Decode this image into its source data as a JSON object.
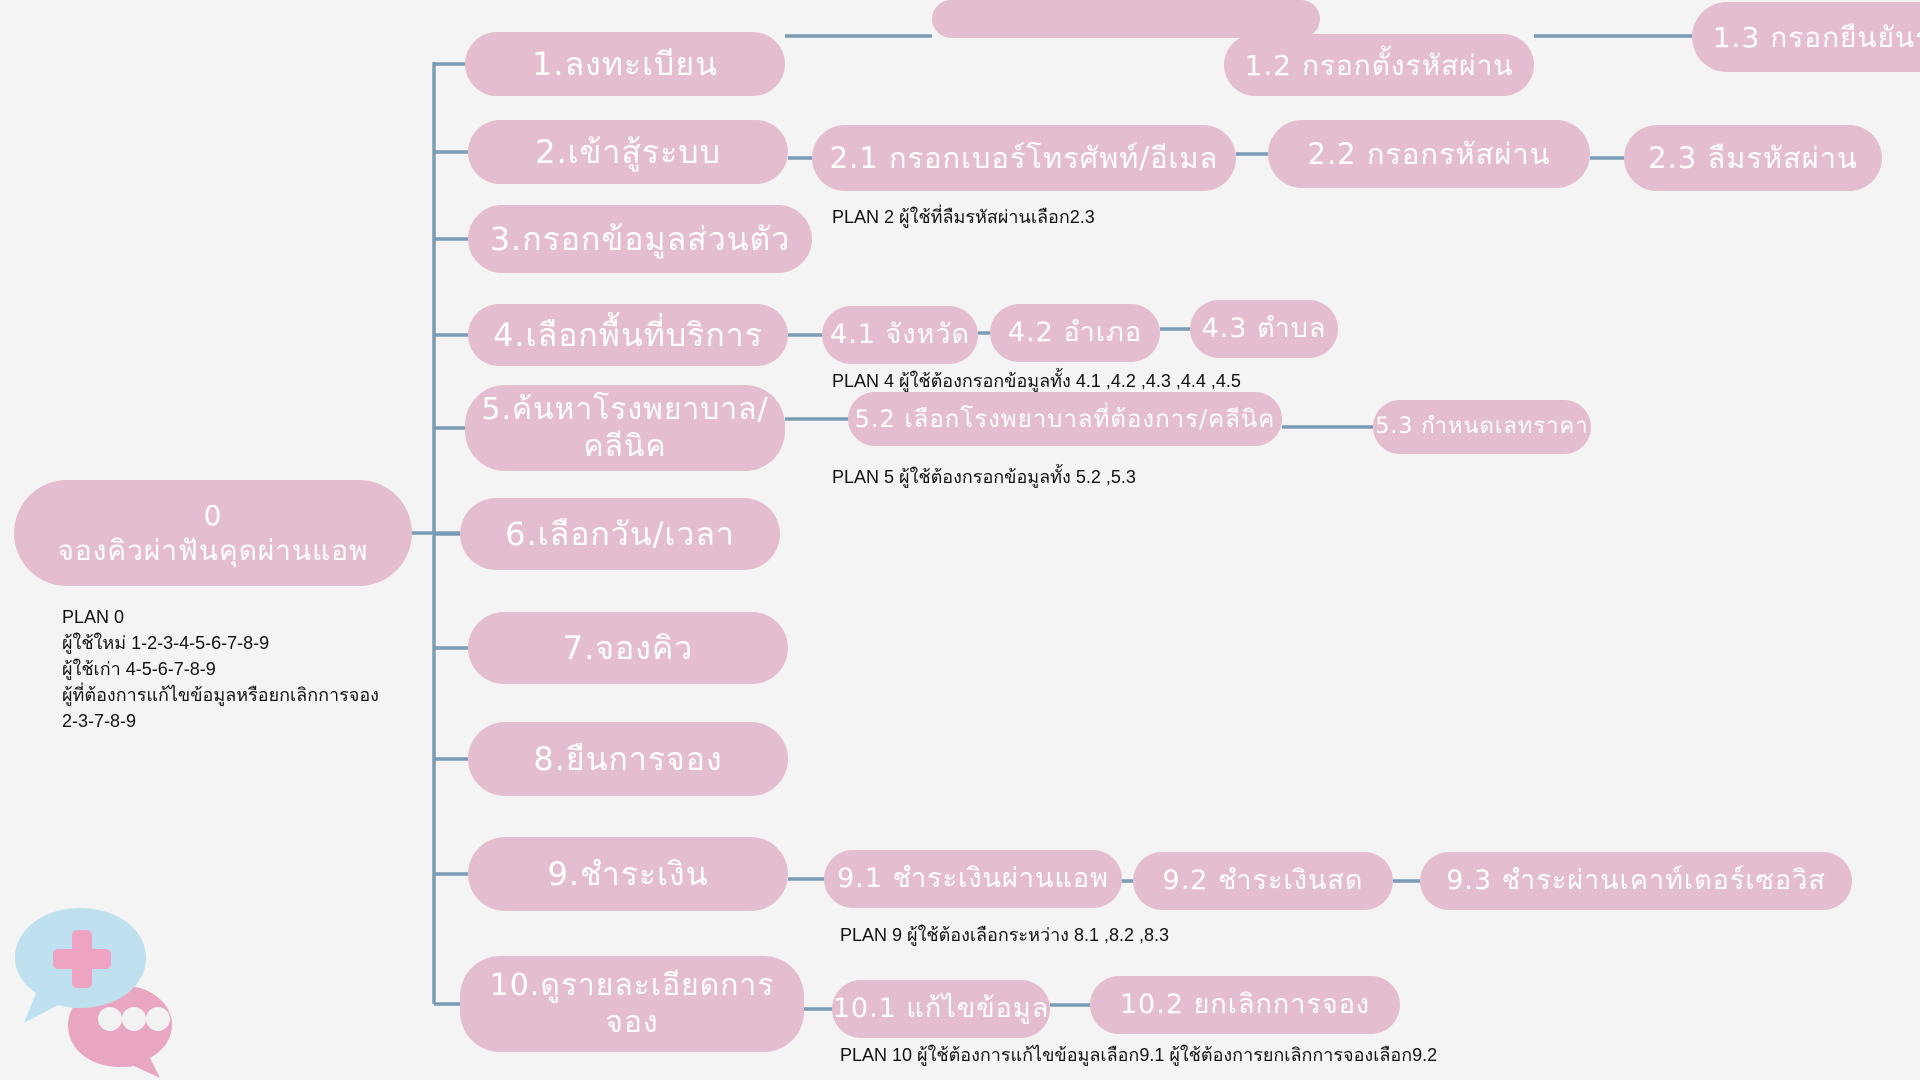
{
  "root": {
    "label": "0\nจองคิวผ่าฟันคุดผ่านแอพ"
  },
  "steps": [
    {
      "label": "1.ลงทะเบียน",
      "subs": [
        {
          "label": "1.2 กรอกตั้งรหัสผ่าน"
        },
        {
          "label": "1.3 กรอกยืนยันร"
        }
      ]
    },
    {
      "label": "2.เข้าสู้ระบบ",
      "subs": [
        {
          "label": "2.1 กรอกเบอร์โทรศัพท์/อีเมล"
        },
        {
          "label": "2.2 กรอกรหัสผ่าน"
        },
        {
          "label": "2.3 ลืมรหัสผ่าน"
        }
      ],
      "plan": "PLAN 2 ผู้ใช้ที่ลืมรหัสผ่านเลือก2.3"
    },
    {
      "label": "3.กรอกข้อมูลส่วนตัว",
      "subs": []
    },
    {
      "label": "4.เลือกพื้นที่บริการ",
      "subs": [
        {
          "label": "4.1 จังหวัด"
        },
        {
          "label": "4.2 อำเภอ"
        },
        {
          "label": "4.3 ตำบล"
        }
      ],
      "plan": "PLAN 4 ผู้ใช้ต้องกรอกข้อมูลทั้ง 4.1 ,4.2 ,4.3 ,4.4 ,4.5"
    },
    {
      "label": "5.ค้นหาโรงพยาบาล/\nคลีนิค",
      "subs": [
        {
          "label": "5.2 เลือกโรงพยาบาลที่ต้องการ/คลีนิค"
        },
        {
          "label": "5.3 กำหนดเลทราคา"
        }
      ],
      "plan": "PLAN 5 ผู้ใช้ต้องกรอกข้อมูลทั้ง 5.2 ,5.3"
    },
    {
      "label": "6.เลือกวัน/เวลา",
      "subs": []
    },
    {
      "label": "7.จองคิว",
      "subs": []
    },
    {
      "label": "8.ยืนการจอง",
      "subs": []
    },
    {
      "label": "9.ชำระเงิน",
      "subs": [
        {
          "label": "9.1 ชำระเงินผ่านแอพ"
        },
        {
          "label": "9.2 ชำระเงินสด"
        },
        {
          "label": "9.3 ชำระผ่านเคาท์เตอร์เซอวิส"
        }
      ],
      "plan": "PLAN 9 ผู้ใช้ต้องเลือกระหว่าง 8.1 ,8.2 ,8.3"
    },
    {
      "label": "10.ดูรายละเอียดการ\nจอง",
      "subs": [
        {
          "label": "10.1 แก้ไขข้อมูล"
        },
        {
          "label": "10.2 ยกเลิกการจอง"
        }
      ],
      "plan": "PLAN 10 ผู้ใช้ต้องการแก้ไขข้อมูลเลือก9.1  ผู้ใช้ต้องการยกเลิกการจองเลือก9.2"
    }
  ],
  "plan0": "PLAN 0\nผู้ใช้ใหม่ 1-2-3-4-5-6-7-8-9\nผู้ใช้เก่า 4-5-6-7-8-9\nผู้ที่ต้องการแก้ไขข้อมูลหรือยกเลิกการจอง\n2-3-7-8-9",
  "colors": {
    "node": "#e4bdd1",
    "line": "#7a9bb4",
    "background": "#f4f4f4"
  },
  "icons": {
    "chat": "medical-chat-bubbles-icon"
  }
}
